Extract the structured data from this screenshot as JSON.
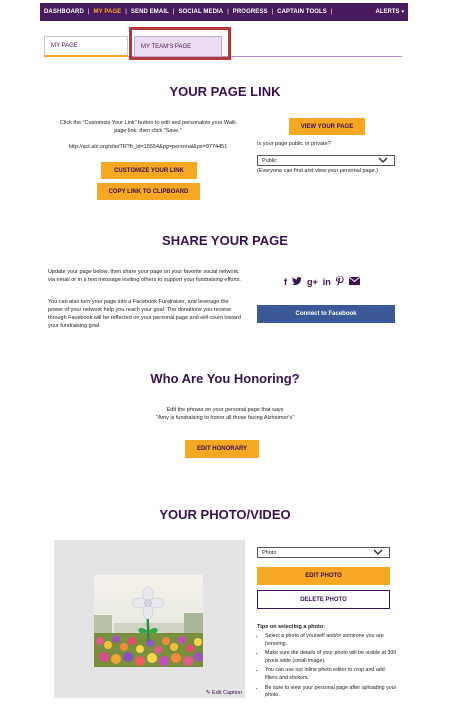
{
  "nav": {
    "items": [
      "DASHBOARD",
      "MY PAGE",
      "SEND EMAIL",
      "SOCIAL MEDIA",
      "PROGRESS",
      "CAPTAIN TOOLS"
    ],
    "separator": "|",
    "alerts": "ALERTS",
    "alerts_caret": "▾"
  },
  "tabs": {
    "my_page": "MY PAGE",
    "team_page": "MY TEAM'S PAGE"
  },
  "page_link": {
    "title": "YOUR PAGE LINK",
    "instructions": "Click the \"Customize Your Link\" button to edit and personalize your Walk page link, then click \"Save.\"",
    "url": "http://act.alz.org/site/TR?fr_id=15554&pg=personal&px=9774451",
    "customize_label": "CUSTOMIZE YOUR LINK",
    "copy_label": "COPY LINK TO CLIPBOARD",
    "view_label": "VIEW YOUR PAGE",
    "privacy_question": "Is your page public or private?",
    "privacy_value": "Public",
    "privacy_note": "(Everyone can find and view your personal page.)"
  },
  "share": {
    "title": "SHARE YOUR PAGE",
    "para1": "Update your page below, then share your page on your favorite social network, via email or in a text message inviting others to support your fundraising efforts.",
    "para2": "You can also turn your page into a Facebook Fundraiser, and leverage the power of your network help you reach your goal. The donations you receive through Facebook will be reflected on your personal page and will count toward your fundraising goal.",
    "icons": {
      "facebook": "f",
      "twitter": "🐦",
      "googleplus": "g+",
      "linkedin": "in",
      "pinterest": "𝓅",
      "email": "✉"
    },
    "connect_label": "Connect to Facebook"
  },
  "honoring": {
    "title": "Who Are You Honoring?",
    "line1": "Edit the phrase on your personal page that says",
    "line2": "\"Amy is fundraising to honor all those facing Alzheimer's\"",
    "button": "EDIT HONORARY"
  },
  "photo": {
    "title": "YOUR PHOTO/VIDEO",
    "select_value": "Photo",
    "edit_label": "EDIT PHOTO",
    "delete_label": "DELETE PHOTO",
    "edit_caption": "Edit Caption",
    "tips_title": "Tips on selecting a photo:",
    "tips": [
      "Select a photo of yourself and/or someone you are honoring.",
      "Make sure the details of your photo will be visible at 300 pixels wide (small image).",
      "You can use our inline photo editor to crop and add filters and stickers.",
      "Be sure to view your personal page after uploading your photo."
    ]
  }
}
